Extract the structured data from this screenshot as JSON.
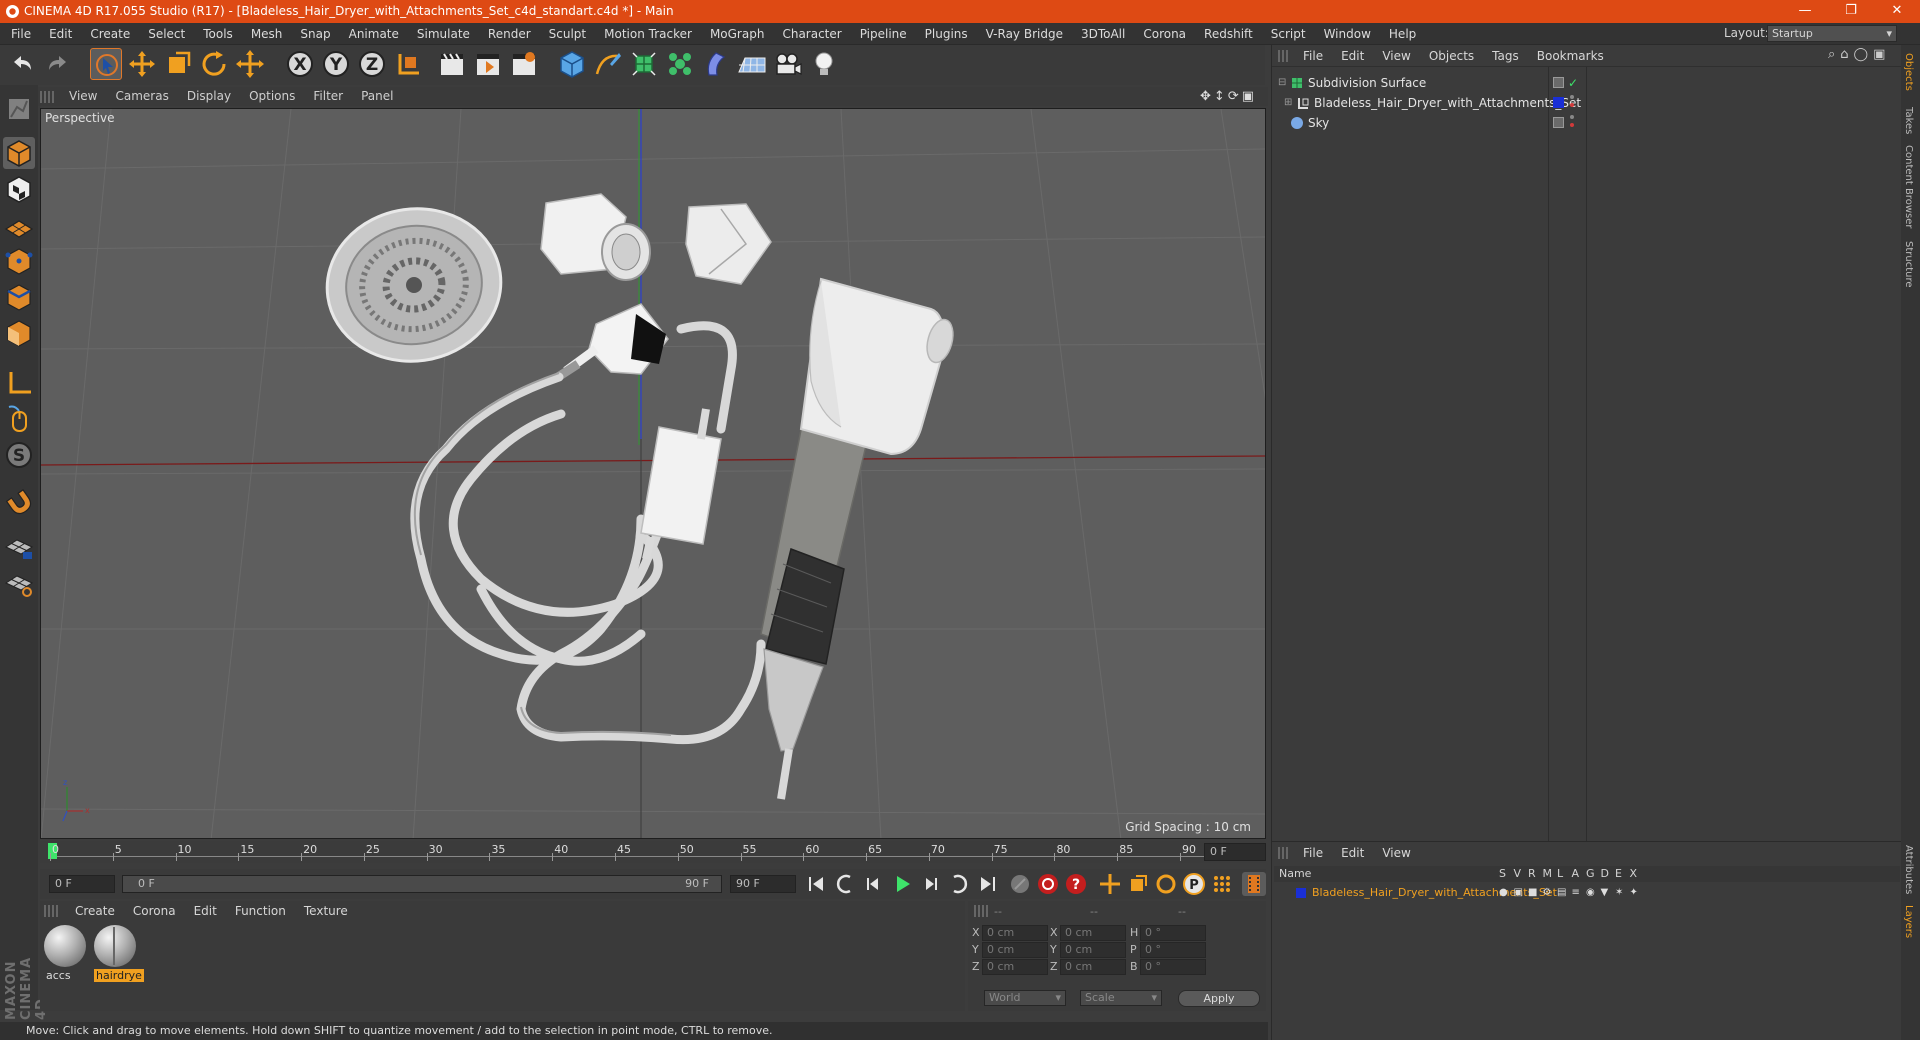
{
  "window": {
    "title": "CINEMA 4D R17.055 Studio (R17) - [Bladeless_Hair_Dryer_with_Attachments_Set_c4d_standart.c4d *] - Main",
    "layout_label": "Layout:",
    "layout_value": "Startup",
    "accent_color": "#de4a14"
  },
  "menu": [
    "File",
    "Edit",
    "Create",
    "Select",
    "Tools",
    "Mesh",
    "Snap",
    "Animate",
    "Simulate",
    "Render",
    "Sculpt",
    "Motion Tracker",
    "MoGraph",
    "Character",
    "Pipeline",
    "Plugins",
    "V-Ray Bridge",
    "3DToAll",
    "Corona",
    "Redshift",
    "Script",
    "Window",
    "Help"
  ],
  "viewport": {
    "menu": [
      "View",
      "Cameras",
      "Display",
      "Options",
      "Filter",
      "Panel"
    ],
    "label": "Perspective",
    "grid_spacing": "Grid Spacing : 10 cm"
  },
  "timeline": {
    "ticks": [
      "0",
      "5",
      "10",
      "15",
      "20",
      "25",
      "30",
      "35",
      "40",
      "45",
      "50",
      "55",
      "60",
      "65",
      "70",
      "75",
      "80",
      "85",
      "90"
    ],
    "current_frame": "0 F",
    "start_frame": "0 F",
    "slider_left": "0 F",
    "slider_right": "90 F",
    "end_frame": "90 F"
  },
  "materials": {
    "menu": [
      "Create",
      "Corona",
      "Edit",
      "Function",
      "Texture"
    ],
    "items": [
      {
        "name": "accs",
        "selected": false
      },
      {
        "name": "hairdrye",
        "selected": true
      }
    ]
  },
  "coordinates": {
    "headers": [
      "--",
      "--",
      "--"
    ],
    "rows": [
      {
        "a": "X",
        "a_val": "0 cm",
        "b": "X",
        "b_val": "0 cm",
        "c": "H",
        "c_val": "0 °"
      },
      {
        "a": "Y",
        "a_val": "0 cm",
        "b": "Y",
        "b_val": "0 cm",
        "c": "P",
        "c_val": "0 °"
      },
      {
        "a": "Z",
        "a_val": "0 cm",
        "b": "Z",
        "b_val": "0 cm",
        "c": "B",
        "c_val": "0 °"
      }
    ],
    "mode": "World",
    "transform": "Scale",
    "apply": "Apply"
  },
  "status": "Move: Click and drag to move elements. Hold down SHIFT to quantize movement / add to the selection in point mode, CTRL to remove.",
  "object_manager": {
    "menu": [
      "File",
      "Edit",
      "View",
      "Objects",
      "Tags",
      "Bookmarks"
    ],
    "objects": [
      {
        "name": "Subdivision Surface"
      },
      {
        "name": "Bladeless_Hair_Dryer_with_Attachments_Set"
      },
      {
        "name": "Sky"
      }
    ]
  },
  "layer_manager": {
    "menu": [
      "File",
      "Edit",
      "View"
    ],
    "col_name": "Name",
    "flags": [
      "S",
      "V",
      "R",
      "M",
      "L",
      "A",
      "G",
      "D",
      "E",
      "X"
    ],
    "layer_name": "Bladeless_Hair_Dryer_with_Attachments_Set",
    "layer_color": "#1a2fd6"
  },
  "side_tabs": [
    "Objects",
    "Takes",
    "Content Browser",
    "Structure",
    "Attributes",
    "Layers"
  ],
  "brand": "MAXON CINEMA 4D"
}
